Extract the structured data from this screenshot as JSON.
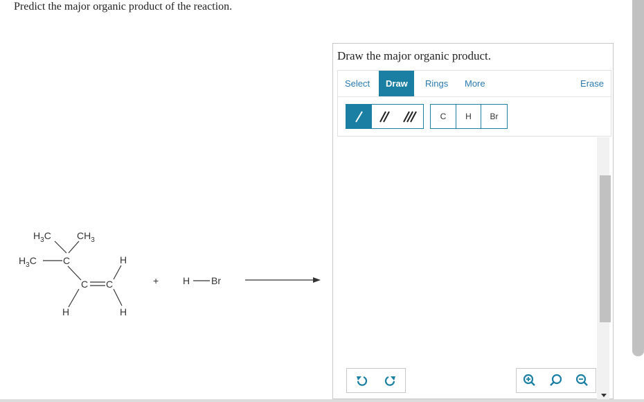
{
  "question": "Predict the major organic product of the reaction.",
  "reaction": {
    "labels": {
      "h3c_top": "H3C",
      "ch3_top": "CH3",
      "h3c_left": "H3C",
      "c_quaternary": "C",
      "h_right_top": "H",
      "c_alkene_left": "C",
      "c_alkene_right": "C",
      "h_bottom_left": "H",
      "h_bottom_right": "H",
      "plus": "+",
      "h_reagent": "H",
      "br_reagent": "Br"
    }
  },
  "editor": {
    "title": "Draw the major organic product.",
    "tabs": [
      "Select",
      "Draw",
      "Rings",
      "More"
    ],
    "active_tab": "Draw",
    "erase_label": "Erase",
    "bond_tools": [
      "single-bond",
      "double-bond",
      "triple-bond"
    ],
    "active_bond": "single-bond",
    "atom_tools": [
      "C",
      "H",
      "Br"
    ],
    "bottom_left_tools": [
      "undo",
      "redo"
    ],
    "bottom_right_tools": [
      "zoom-in",
      "reset-zoom",
      "zoom-out"
    ]
  },
  "colors": {
    "accent": "#1b7fa3",
    "link": "#2a7ab0",
    "scroll": "#c1c1c1",
    "border": "#c8c8c8"
  }
}
